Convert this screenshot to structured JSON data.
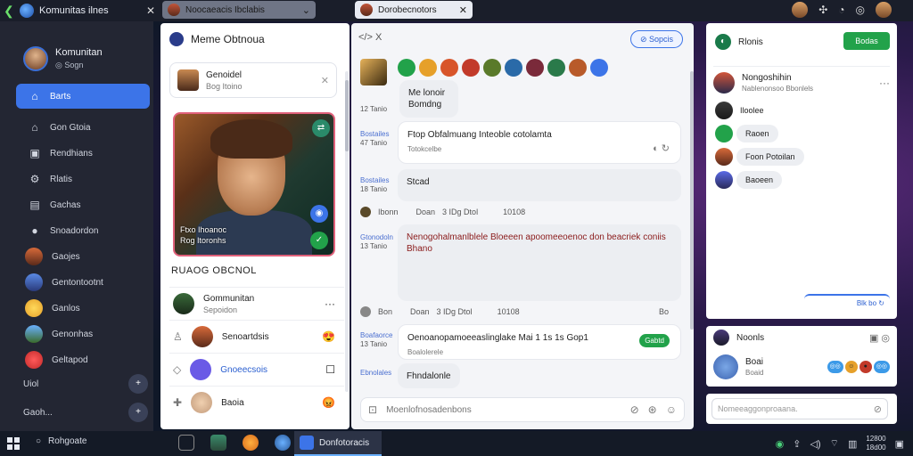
{
  "window": {
    "app_title": "Komunitas ilnes",
    "tabs": [
      {
        "label": "Noocaeacis Ibclabis"
      },
      {
        "label": "Dorobecnotors"
      }
    ]
  },
  "sidebar": {
    "profile_name": "Komunitan",
    "profile_status": "Sogn",
    "items": [
      {
        "label": "Barts",
        "icon": "home-icon"
      },
      {
        "label": "Gon Gtoia",
        "icon": "house-icon"
      },
      {
        "label": "Rendhians",
        "icon": "camera-icon"
      },
      {
        "label": "Rlatis",
        "icon": "settings-icon"
      },
      {
        "label": "Gachas",
        "icon": "grid-icon"
      },
      {
        "label": "Snoadordon",
        "icon": "chat-icon"
      },
      {
        "label": "Gaojes",
        "icon": "avatar"
      },
      {
        "label": "Gentontootnt",
        "icon": "avatar"
      },
      {
        "label": "Ganlos",
        "icon": "avatar"
      },
      {
        "label": "Genonhas",
        "icon": "avatar"
      },
      {
        "label": "Geltapod",
        "icon": "avatar"
      }
    ],
    "bottom": [
      {
        "label": "Uiol",
        "button": "+"
      },
      {
        "label": "Gaoh...",
        "button": "+"
      }
    ]
  },
  "panel": {
    "title": "Meme Obtnoua",
    "search_card": {
      "title": "Genoidel",
      "subtitle": "Bog Itoino"
    },
    "hero_caption": "Ftxo Ihoanoc\nRog Itoronhs",
    "section_title": "RUAOG OBCNOL",
    "list": [
      {
        "title": "Gommunitan",
        "subtitle": "Sepoidon"
      },
      {
        "title": "Senoartdsis",
        "subtitle": ""
      },
      {
        "title": "Gnoeecsois",
        "subtitle": ""
      },
      {
        "title": "Baoia",
        "subtitle": ""
      }
    ]
  },
  "chat": {
    "header_icons": "</> X",
    "header_button": "Sopcis",
    "messages": [
      {
        "time": "12 Tanio",
        "text": "Me lonoir\nBomdng",
        "style": "grey"
      },
      {
        "time_a": "Bostailes",
        "time_b": "47 Tanio",
        "text": "Ftop Obfalmuang Inteoble cotolamta",
        "sub": "Totokcelbe",
        "style": "white"
      },
      {
        "time_a": "Bostailes",
        "time_b": "18 Tanio",
        "text": "Stcad",
        "style": "grey"
      },
      {
        "time_a": "Gtonodoln",
        "time_b": "13 Tanio",
        "text": "Nenogohalmanlblele Bloeeen apoomeeoenoc don beacriek coniis Bhano",
        "style": "grey-large"
      },
      {
        "time_a": "Boafaorce",
        "time_b": "13 Tanio",
        "text": "Oenoanopamoeeaslinglake Mai 1 1s 1s Gop1",
        "sub": "Boalolerele",
        "badge": "Gabtd",
        "style": "white"
      },
      {
        "time_a": "Ebnolales",
        "time_b": "",
        "text": "Fhndalonle",
        "style": "grey"
      }
    ],
    "meta_rows": [
      {
        "name": "Ibonn",
        "a": "Doan",
        "b": "3 IDg Dtol",
        "c": "10108"
      },
      {
        "name": "Bon",
        "a": "Doan",
        "b": "3 IDg Dtol",
        "c": "10108",
        "d": "Bo"
      }
    ],
    "composer_placeholder": "Moenlofnosadenbons"
  },
  "right": {
    "header_title": "Rlonis",
    "header_button": "Bodas",
    "top_row": {
      "title": "Nongoshihin",
      "subtitle": "Nablenonsoo Bbonlels"
    },
    "chips": [
      "Iloolee",
      "Raoen",
      "Foon Potoilan",
      "Baoeen"
    ],
    "footer_link": "Blk bo",
    "card": {
      "title": "Noonls",
      "name": "Boai",
      "sub": "Boaid"
    },
    "input_placeholder": "Nomeeaggonproaana."
  },
  "taskbar": {
    "search_label": "Rohgoate",
    "active_app": "Donfotoracis",
    "clock_time": "12800",
    "clock_date": "18d00"
  },
  "colors": {
    "accent": "#3c74e8",
    "green": "#22a24a",
    "sidebar_bg": "#232633",
    "hero_border": "#e0607a"
  }
}
